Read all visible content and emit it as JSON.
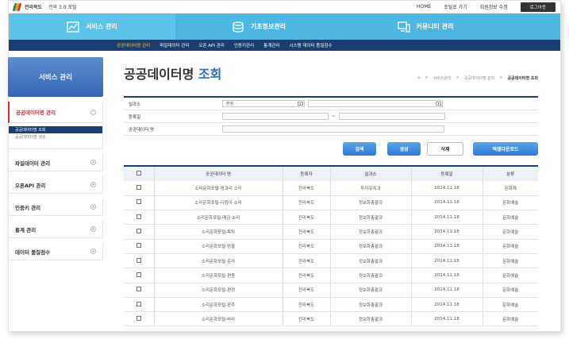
{
  "header": {
    "logo_text": "전라북도",
    "logo_sub": "전북 3.0 포털",
    "links": [
      "HOME",
      "포털로 가기",
      "회원정보 수정"
    ],
    "logout": "로그아웃"
  },
  "main_nav": [
    {
      "label": "서비스 관리",
      "icon": "chart-icon"
    },
    {
      "label": "기초정보관리",
      "icon": "database-icon"
    },
    {
      "label": "커뮤니티 관리",
      "icon": "monitor-icon"
    }
  ],
  "sub_nav": [
    "공공데이터명 관리",
    "파일데이터 관리",
    "오픈 API 관리",
    "인증키관리",
    "통계관리",
    "시스템 데이터 품질검수"
  ],
  "sidebar": {
    "title": "서비스 관리",
    "active_item": "공공데이터명 관리",
    "sub_items": [
      "공공데이터명 조회",
      "공공데이터명 생성"
    ],
    "items": [
      "파일데이터 관리",
      "오픈API 관리",
      "인증키 관리",
      "통계 관리",
      "데이터 품질검수"
    ]
  },
  "page": {
    "title_main": "공공데이터명",
    "title_accent": "조회",
    "breadcrumb": [
      "⌂",
      "서비스관리",
      "공공데이터명 관리",
      "공공데이터명 조회"
    ]
  },
  "form": {
    "office_label": "실과소",
    "office_value": "본청",
    "date_label": "등록일",
    "date_sep": "~",
    "name_label": "공공데이터 명"
  },
  "buttons": {
    "search": "검색",
    "create": "생성",
    "delete": "삭제",
    "excel": "엑셀다운로드"
  },
  "table": {
    "columns": [
      "공공데이터 명",
      "등록자",
      "실과소",
      "등록일",
      "분류"
    ],
    "rows": [
      [
        "소리문화포털-명과리 소리",
        "전라북도",
        "투자유치과",
        "2014.11.18",
        "문화재"
      ],
      [
        "소리문화포털-다듬이 소리",
        "전라북도",
        "정보화총괄과",
        "2014.11.18",
        "문화예술"
      ],
      [
        "소리문화포털-매금 소리",
        "전라북도",
        "정보화총괄과",
        "2014.11.18",
        "문화예술"
      ],
      [
        "소리문화포털-목탁",
        "전라북도",
        "정보화총괄과",
        "2014.11.18",
        "문화예술"
      ],
      [
        "소리문화포털-방울",
        "전라북도",
        "정보화총괄과",
        "2014.11.18",
        "문화예술"
      ],
      [
        "소리문화포털-운라",
        "전라북도",
        "정보화총괄과",
        "2014.11.18",
        "문화예술"
      ],
      [
        "소리문화포털-편종",
        "전라북도",
        "정보화총괄과",
        "2014.11.18",
        "문화예술"
      ],
      [
        "소리문화포털-편경",
        "전라북도",
        "정보화총괄과",
        "2014.11.18",
        "문화예술"
      ],
      [
        "소리문화포털-장주",
        "전라북도",
        "정보화총괄과",
        "2014.11.18",
        "문화예술"
      ],
      [
        "소리문화포털-바라",
        "전라북도",
        "정보화총괄과",
        "2014.11.18",
        "문화예술"
      ]
    ]
  },
  "colors": {
    "nav_blue": "#4db7e2",
    "dark_navy": "#1a3e72",
    "accent_red": "#c8313b",
    "title_blue": "#2d6bc4"
  }
}
